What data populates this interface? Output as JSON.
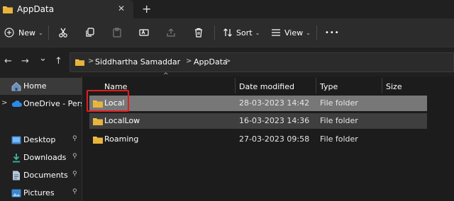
{
  "window": {
    "tab_title": "AppData",
    "close_glyph": "✕",
    "new_tab_glyph": "+"
  },
  "commandbar": {
    "new_label": "New",
    "sort_label": "Sort",
    "view_label": "View",
    "more_glyph": "•••",
    "icons": [
      "cut-icon",
      "copy-icon",
      "paste-icon",
      "rename-icon",
      "share-icon",
      "delete-icon"
    ]
  },
  "navigation": {
    "back_glyph": "←",
    "forward_glyph": "→",
    "recent_glyph": "⌄",
    "up_glyph": "↑"
  },
  "breadcrumb": {
    "items": [
      "Siddhartha Samaddar",
      "AppData"
    ],
    "separator": ">"
  },
  "sidebar": {
    "items": [
      {
        "label": "Home",
        "icon": "home-icon",
        "selected": true
      },
      {
        "label": "OneDrive - Persona",
        "icon": "cloud-icon",
        "expand": ">"
      },
      {
        "label": "Desktop",
        "icon": "desktop-icon",
        "pinned": true
      },
      {
        "label": "Downloads",
        "icon": "download-icon",
        "pinned": true
      },
      {
        "label": "Documents",
        "icon": "document-icon",
        "pinned": true
      },
      {
        "label": "Pictures",
        "icon": "picture-icon",
        "pinned": true
      }
    ],
    "pin_glyph": "📌"
  },
  "columns": {
    "name": "Name",
    "date_modified": "Date modified",
    "type": "Type",
    "size": "Size",
    "sort_indicator": "^"
  },
  "files": [
    {
      "name": "Local",
      "date_modified": "28-03-2023 14:42",
      "type": "File folder"
    },
    {
      "name": "LocalLow",
      "date_modified": "16-03-2023 14:36",
      "type": "File folder"
    },
    {
      "name": "Roaming",
      "date_modified": "27-03-2023 09:58",
      "type": "File folder"
    }
  ],
  "colors": {
    "highlight_box": "#e21d1d",
    "folder": "#f2c14e",
    "selected_row": "#777777",
    "hover_row": "#3f3f3f"
  }
}
